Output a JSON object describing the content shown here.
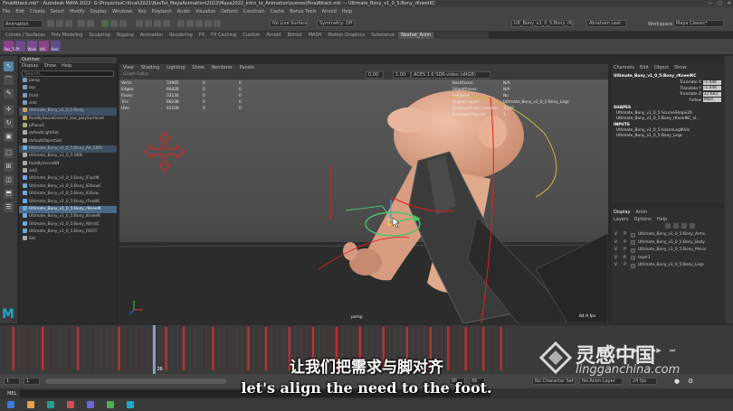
{
  "window": {
    "title": "FinalAttack.mb* - Autodesk MAYA 2022: G:\\ProyectosCritical\\2021\\NxsTut_MayaAnimation\\2022\\Maya2022_Intro_to_Animation\\scenes\\FinalAttack.mb   ---   Ultimate_Bony_v1_0_5:Bony_rKneeIKC",
    "controls": [
      "—",
      "□",
      "✕"
    ]
  },
  "menubar": {
    "items": [
      "File",
      "Edit",
      "Create",
      "Select",
      "Modify",
      "Display",
      "Windows",
      "Key",
      "Playback",
      "Audio",
      "Visualize",
      "Deform",
      "Constrain",
      "Cache",
      "Bonus Tools",
      "Arnold",
      "Help"
    ]
  },
  "statusline": {
    "mode": "Animation",
    "no_live_surface": "No Live Surface",
    "symmetry": "Symmetry: Off",
    "object_field": "Ult_Bony_v1_0_5:Bony_rKneeIKC",
    "renderer_field": "Abraham Leal",
    "workspace_label": "Workspace :",
    "workspace": "Maya Classic*"
  },
  "shelf": {
    "tabs": [
      "Curves / Surfaces",
      "Poly Modeling",
      "Sculpting",
      "Rigging",
      "Animation",
      "Rendering",
      "FX",
      "FX Caching",
      "Custom",
      "Arnold",
      "Bifrost",
      "MASH",
      "Motion Graphics",
      "Substance",
      "Nexhat_Anim"
    ],
    "active_tab": "Nexhat_Anim",
    "buttons": [
      {
        "label": "Pos_Tut",
        "color": "#8a3f8f"
      },
      {
        "label": "Pf",
        "color": "#6c4b8c"
      },
      {
        "label": "Walk",
        "color": "#7a4a90"
      },
      {
        "label": "Ulti",
        "color": "#8e4088"
      },
      {
        "label": "Hair",
        "color": "#5c4f86"
      }
    ]
  },
  "outliner": {
    "title": "Outliner",
    "menu": [
      "Display",
      "Show",
      "Help"
    ],
    "search_placeholder": "Search...",
    "items": [
      {
        "label": "persp",
        "color": "#7c9bb8"
      },
      {
        "label": "top",
        "color": "#7c9bb8"
      },
      {
        "label": "front",
        "color": "#7c9bb8"
      },
      {
        "label": "side",
        "color": "#7c9bb8"
      },
      {
        "label": "Ultimate_Bony_v1_0_5:Bony",
        "color": "#c8a060",
        "hl": true
      },
      {
        "label": "RuleBySeoraGreenV_low_polySurface4",
        "color": "#c8a060"
      },
      {
        "label": "pPlane1",
        "color": "#9bb07a"
      },
      {
        "label": "defaultLightSet",
        "color": "#aaaaaa"
      },
      {
        "label": "defaultObjectSet",
        "color": "#aaaaaa"
      },
      {
        "label": "Ultimate_Bony_v1_0_5:Bony_All_CNTs",
        "color": "#6fa8dc",
        "hl": true
      },
      {
        "label": "Ultimate_Bony_v1_0_5:SKN",
        "color": "#aaaaaa"
      },
      {
        "label": "RuleBySeoraBN",
        "color": "#aaaaaa"
      },
      {
        "label": "set1",
        "color": "#aaaaaa"
      },
      {
        "label": "Ultimate_Bony_v1_0_5:Bony_lFootIK",
        "color": "#6fa8dc"
      },
      {
        "label": "Ultimate_Bony_v1_0_5:Bony_lElbowC",
        "color": "#6fa8dc"
      },
      {
        "label": "Ultimate_Bony_v1_0_5:Bony_lElbow",
        "color": "#6fa8dc"
      },
      {
        "label": "Ultimate_Bony_v1_0_5:Bony_rFootIK",
        "color": "#6fa8dc"
      },
      {
        "label": "Ultimate_Bony_v1_0_5:Bony_rKneeIK",
        "color": "#6fa8dc",
        "sel": true
      },
      {
        "label": "Ultimate_Bony_v1_0_5:Bony_lKneeIK",
        "color": "#6fa8dc"
      },
      {
        "label": "Ultimate_Bony_v1_0_5:Bony_lWristC",
        "color": "#6fa8dc"
      },
      {
        "label": "Ultimate_Bony_v1_0_5:Bony_ROOT",
        "color": "#6fa8dc"
      },
      {
        "label": "Set",
        "color": "#aaaaaa"
      }
    ]
  },
  "viewport": {
    "panel_title": "Graph Editor",
    "menu": [
      "View",
      "Shading",
      "Lighting",
      "Show",
      "Renderer",
      "Panels"
    ],
    "color_space": "ACES 1.0 SDR-video (sRGB)",
    "values": [
      "0.00",
      "1.00"
    ],
    "hud_left": [
      {
        "k": "Verts:",
        "v1": "33965",
        "v2": "0",
        "v3": "0"
      },
      {
        "k": "Edges:",
        "v1": "66426",
        "v2": "0",
        "v3": "0"
      },
      {
        "k": "Faces:",
        "v1": "33134",
        "v2": "0",
        "v3": "0"
      },
      {
        "k": "Tris:",
        "v1": "66238",
        "v2": "0",
        "v3": "0"
      },
      {
        "k": "UVs:",
        "v1": "42109",
        "v2": "0",
        "v3": "0"
      }
    ],
    "hud_right": [
      {
        "k": "Backfaces:",
        "v": "N/A"
      },
      {
        "k": "Smoothness:",
        "v": "N/A"
      },
      {
        "k": "Instance:",
        "v": "No"
      },
      {
        "k": "Display Layer:",
        "v": "Ultimate_Bony_v1_0_5:Bony_Legs"
      },
      {
        "k": "Distance From Camera:",
        "v": "3.231"
      },
      {
        "k": "Selected Objects:",
        "v": "1"
      }
    ],
    "camera": "persp",
    "fps": "84.9 fps"
  },
  "channelbox": {
    "menu": [
      "Channels",
      "Edit",
      "Object",
      "Show"
    ],
    "object": "Ultimate_Bony_v1_0_5:Bony_rKneeIKC",
    "attrs": [
      {
        "name": "Translate X",
        "value": "-1.446"
      },
      {
        "name": "Translate Y",
        "value": "-1.446"
      },
      {
        "name": "Translate Z",
        "value": "22.603"
      },
      {
        "name": "Follow",
        "value": "Main"
      }
    ],
    "shapes_label": "SHAPES",
    "shapes": [
      "Ultimate_Bony_v1_0_5:ScurveShape26",
      "Ultimate_Bony_v1_0_5:Bony_rKneeIKC_sl..."
    ],
    "inputs_label": "INPUTS",
    "inputs": [
      "Ultimate_Bony_v1_0_5:lolaneLegIKVis",
      "Ultimate_Bony_v1_0_5:Bony_Legs"
    ]
  },
  "layers": {
    "tabs": [
      "Display",
      "Anim"
    ],
    "menu": [
      "Layers",
      "Options",
      "Help"
    ],
    "rows": [
      {
        "v": "V",
        "p": "P",
        "name": "Ultimate_Bony_v1_0_5:Bony_Arms"
      },
      {
        "v": "V",
        "p": "P",
        "name": "Ultimate_Bony_v1_0_5:Bony_Body"
      },
      {
        "v": "V",
        "p": "P",
        "name": "Ultimate_Bony_v1_0_5:Bony_Pelvis"
      },
      {
        "v": "V",
        "p": "R",
        "name": "layer1"
      },
      {
        "v": "V",
        "p": "P",
        "name": "Ultimate_Bony_v1_0_5:Bony_Legs"
      }
    ]
  },
  "timeline": {
    "start_field": "1",
    "end_field": "86",
    "range_start": "1",
    "range_end": "86",
    "current_frame": "26",
    "no_character_set": "No Character Set",
    "no_anim_layer": "No Anim Layer",
    "fps": "24 fps"
  },
  "cmdline": {
    "label": "MEL"
  },
  "subtitles": {
    "zh": "让我们把需求与脚对齐",
    "en": "let's align the need to the foot."
  },
  "watermark": {
    "cn": "灵感中国",
    "en": "lingganchina.com"
  },
  "colors": {
    "accent": "#5285a6",
    "key_red": "#c03030",
    "viewport_bg": "#4d4d4d",
    "grid": "#2e2e2e"
  }
}
